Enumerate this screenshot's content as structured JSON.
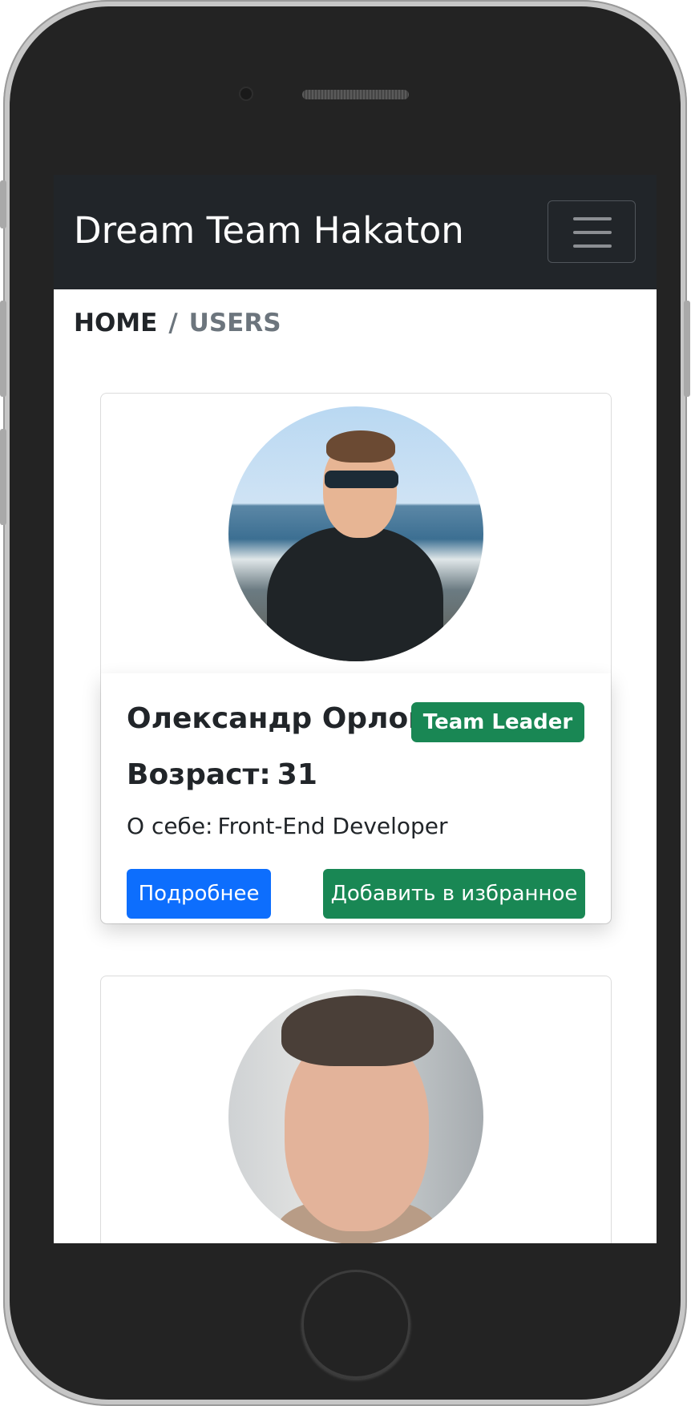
{
  "navbar": {
    "brand": "Dream Team Hakaton",
    "toggler_icon": "hamburger-menu-icon"
  },
  "breadcrumb": {
    "home": "HOME",
    "separator": "/",
    "current": "USERS"
  },
  "users": [
    {
      "name": "Олександр Орлов",
      "badge": "Team Leader",
      "age_label": "Возраст:",
      "age": "31",
      "about_label": "О себе:",
      "about": "Front-End Developer",
      "details_button": "Подробнее",
      "favorite_button": "Добавить в избранное"
    }
  ],
  "colors": {
    "navbar_bg": "#212529",
    "primary": "#0d6efd",
    "success": "#198754",
    "muted": "#6c757d"
  }
}
